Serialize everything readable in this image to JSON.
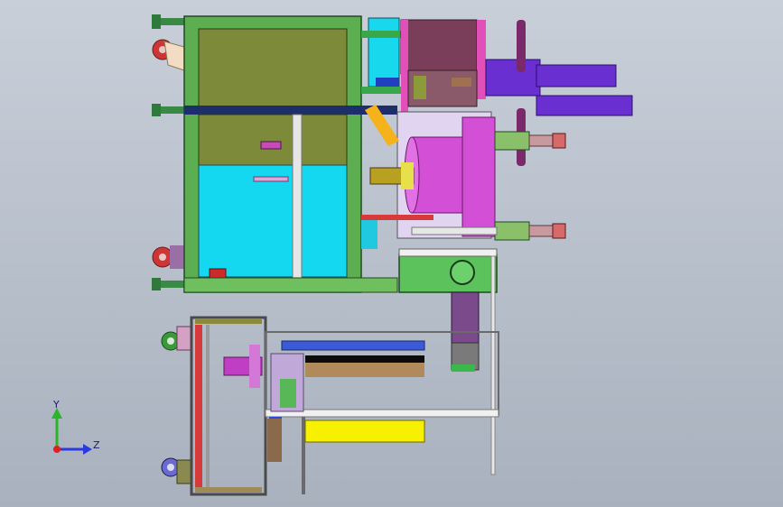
{
  "triad": {
    "y_label": "Y",
    "z_label": "Z"
  },
  "colors": {
    "frame_green": "#5cae50",
    "panel_olive": "#7c8a3a",
    "cyan": "#14d8f0",
    "magenta": "#d24fd6",
    "purple": "#6a2fd0",
    "maroon": "#7a3d5a",
    "yellow": "#f7f000",
    "red": "#d63a3a",
    "axis_y": "#2ab52a",
    "axis_z": "#2a3ae0"
  }
}
